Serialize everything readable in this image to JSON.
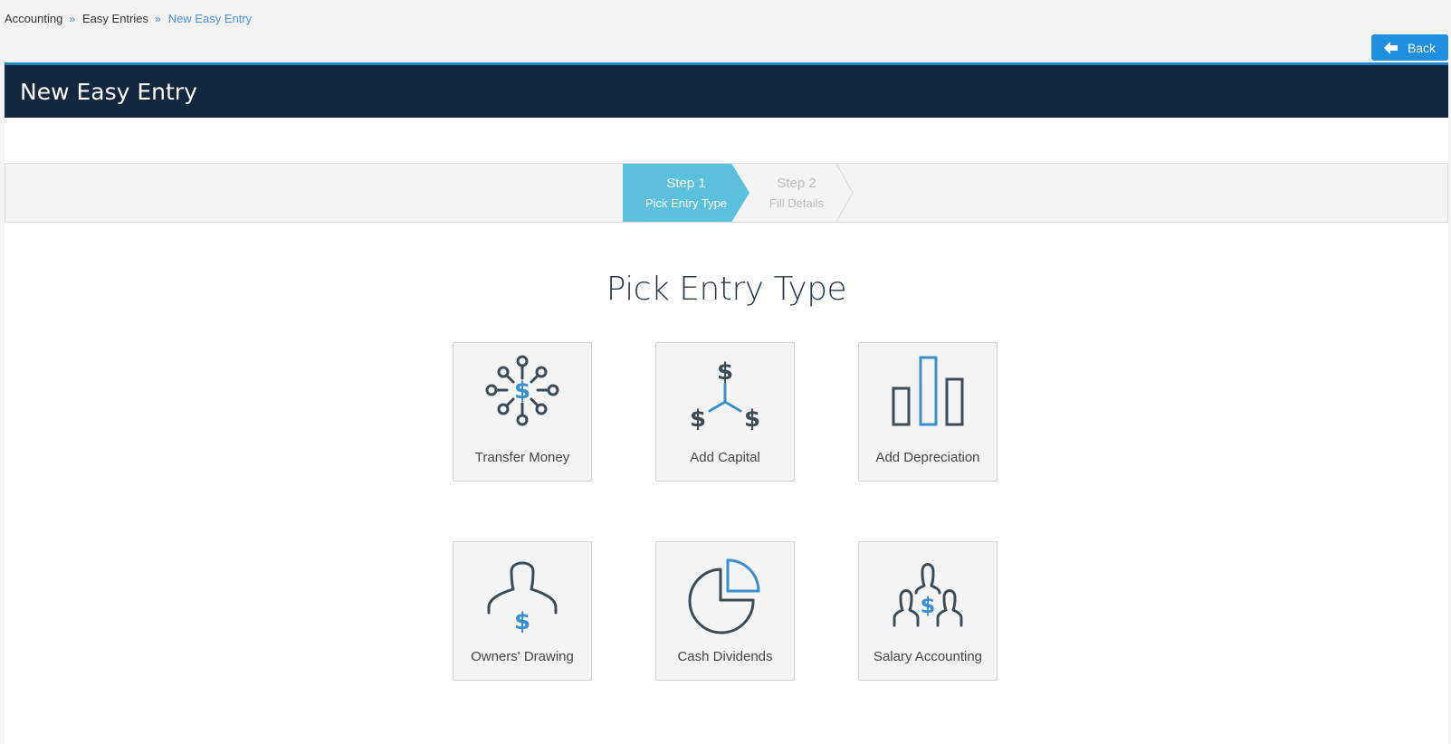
{
  "breadcrumb": {
    "items": [
      "Accounting",
      "Easy Entries"
    ],
    "current": "New Easy Entry",
    "separator": "»"
  },
  "back_button": {
    "label": "Back",
    "icon": "arrow-left-icon"
  },
  "panel": {
    "title": "New Easy Entry"
  },
  "wizard": {
    "steps": [
      {
        "title": "Step 1",
        "subtitle": "Pick Entry Type",
        "active": true
      },
      {
        "title": "Step 2",
        "subtitle": "Fill Details",
        "active": false
      }
    ]
  },
  "main": {
    "heading": "Pick Entry Type",
    "tiles": [
      {
        "label": "Transfer Money",
        "icon": "transfer-money-icon"
      },
      {
        "label": "Add Capital",
        "icon": "add-capital-icon"
      },
      {
        "label": "Add Depreciation",
        "icon": "add-depreciation-icon"
      },
      {
        "label": "Owners' Drawing",
        "icon": "owners-drawing-icon"
      },
      {
        "label": "Cash Dividends",
        "icon": "cash-dividends-icon"
      },
      {
        "label": "Salary Accounting",
        "icon": "salary-accounting-icon"
      }
    ]
  },
  "colors": {
    "dark": "#13283e",
    "accent": "#1f8fe0",
    "step_active": "#5bc0de",
    "icon_dark": "#3d4b57",
    "icon_blue": "#3a8fd0"
  }
}
